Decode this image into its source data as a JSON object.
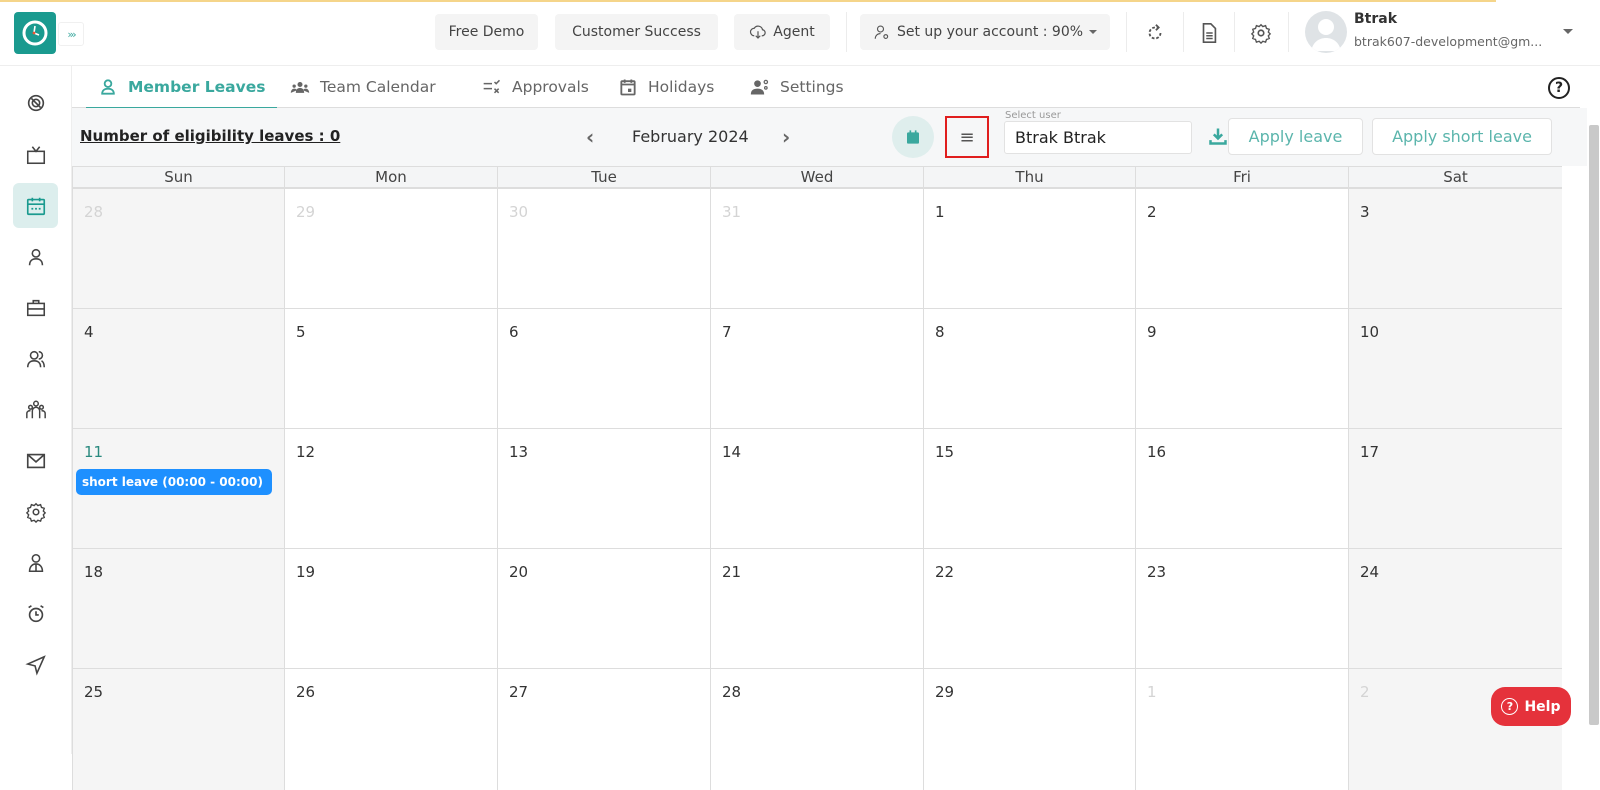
{
  "header": {
    "free_demo": "Free Demo",
    "customer_success": "Customer Success",
    "agent": "Agent",
    "setup_account": "Set up your account : 90%",
    "user_name": "Btrak",
    "user_email": "btrak607-development@gm..."
  },
  "tabs": [
    {
      "label": "Member Leaves",
      "icon": "user-icon",
      "active": true
    },
    {
      "label": "Team Calendar",
      "icon": "team-icon"
    },
    {
      "label": "Approvals",
      "icon": "approvals-icon"
    },
    {
      "label": "Holidays",
      "icon": "calendar-icon"
    },
    {
      "label": "Settings",
      "icon": "user-settings-icon"
    }
  ],
  "sidebar": [
    "dashboard-icon",
    "tv-icon",
    "calendar-icon",
    "user-icon",
    "briefcase-icon",
    "users-icon",
    "team-icon",
    "mail-icon",
    "gear-icon",
    "profile-icon",
    "alarm-icon",
    "send-icon"
  ],
  "toolbar": {
    "eligibility": "Number of eligibility leaves : 0",
    "month": "February 2024",
    "prev": "‹",
    "next": "›",
    "select_label": "Select user",
    "selected_user": "Btrak Btrak",
    "apply_leave": "Apply leave",
    "apply_short_leave": "Apply short leave"
  },
  "calendar": {
    "days_of_week": [
      "Sun",
      "Mon",
      "Tue",
      "Wed",
      "Thu",
      "Fri",
      "Sat"
    ],
    "weeks": [
      [
        "28",
        "29",
        "30",
        "31",
        "1",
        "2",
        "3"
      ],
      [
        "4",
        "5",
        "6",
        "7",
        "8",
        "9",
        "10"
      ],
      [
        "11",
        "12",
        "13",
        "14",
        "15",
        "16",
        "17"
      ],
      [
        "18",
        "19",
        "20",
        "21",
        "22",
        "23",
        "24"
      ],
      [
        "25",
        "26",
        "27",
        "28",
        "29",
        "1",
        "2"
      ]
    ],
    "event": {
      "day": "11",
      "label": "short leave (00:00 - 00:00)",
      "color": "#1e90ff"
    }
  },
  "help": "Help",
  "colors": {
    "accent": "#3aa89e",
    "help": "#e5323b"
  }
}
